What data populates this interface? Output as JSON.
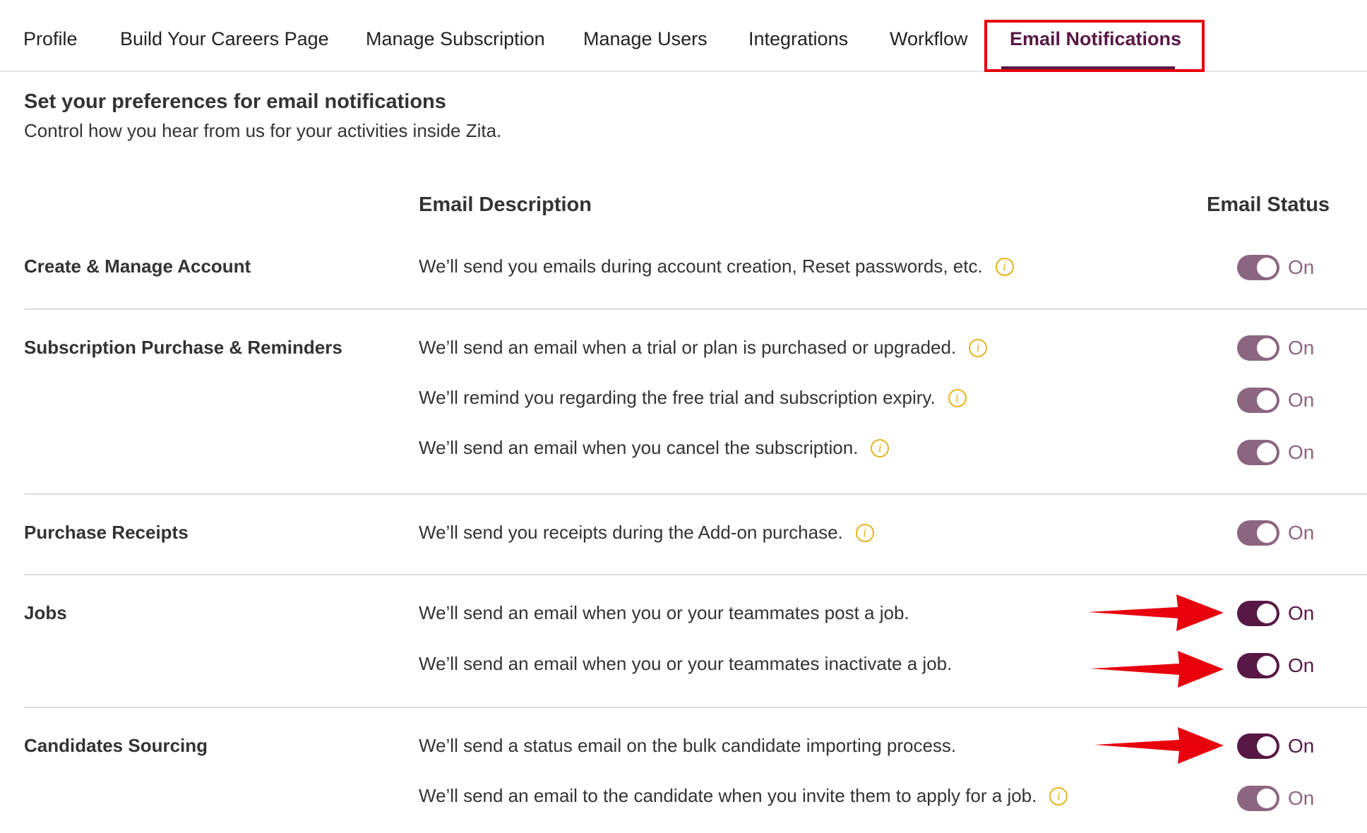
{
  "tabs": [
    {
      "label": "Profile",
      "active": false
    },
    {
      "label": "Build Your Careers Page",
      "active": false
    },
    {
      "label": "Manage Subscription",
      "active": false
    },
    {
      "label": "Manage Users",
      "active": false
    },
    {
      "label": "Integrations",
      "active": false
    },
    {
      "label": "Workflow",
      "active": false
    },
    {
      "label": "Email Notifications",
      "active": true
    }
  ],
  "header": {
    "title": "Set your preferences for email notifications",
    "subtitle": "Control how you hear from us for your activities inside Zita."
  },
  "columns": {
    "description": "Email Description",
    "status": "Email Status"
  },
  "colors": {
    "brand": "#581845",
    "toggle_muted": "#8c6680",
    "info_icon": "#e6b422",
    "annotation": "#e8000d"
  },
  "sections": [
    {
      "title": "Create & Manage Account",
      "rows": [
        {
          "description": "We’ll send you emails during account creation, Reset passwords, etc.",
          "status": "On",
          "info": true
        }
      ]
    },
    {
      "title": "Subscription Purchase & Reminders",
      "rows": [
        {
          "description": "We’ll send an email when a trial or plan is purchased or upgraded.",
          "status": "On",
          "info": true
        },
        {
          "description": "We’ll remind you regarding the free trial and subscription expiry.",
          "status": "On",
          "info": true
        },
        {
          "description": "We’ll send an email when you cancel the subscription.",
          "status": "On",
          "info": true
        }
      ]
    },
    {
      "title": "Purchase Receipts",
      "rows": [
        {
          "description": "We’ll send you receipts during the Add-on purchase.",
          "status": "On",
          "info": true
        }
      ]
    },
    {
      "title": "Jobs",
      "rows": [
        {
          "description": "We’ll send an email when you or your teammates post a job.",
          "status": "On",
          "info": false
        },
        {
          "description": "We’ll send an email when you or your teammates inactivate a job.",
          "status": "On",
          "info": false
        }
      ]
    },
    {
      "title": "Candidates Sourcing",
      "rows": [
        {
          "description": "We’ll send a status email on the bulk candidate importing process.",
          "status": "On",
          "info": false
        },
        {
          "description": "We’ll send an email to the candidate when you invite them to apply for a job.",
          "status": "On",
          "info": true
        }
      ]
    }
  ]
}
